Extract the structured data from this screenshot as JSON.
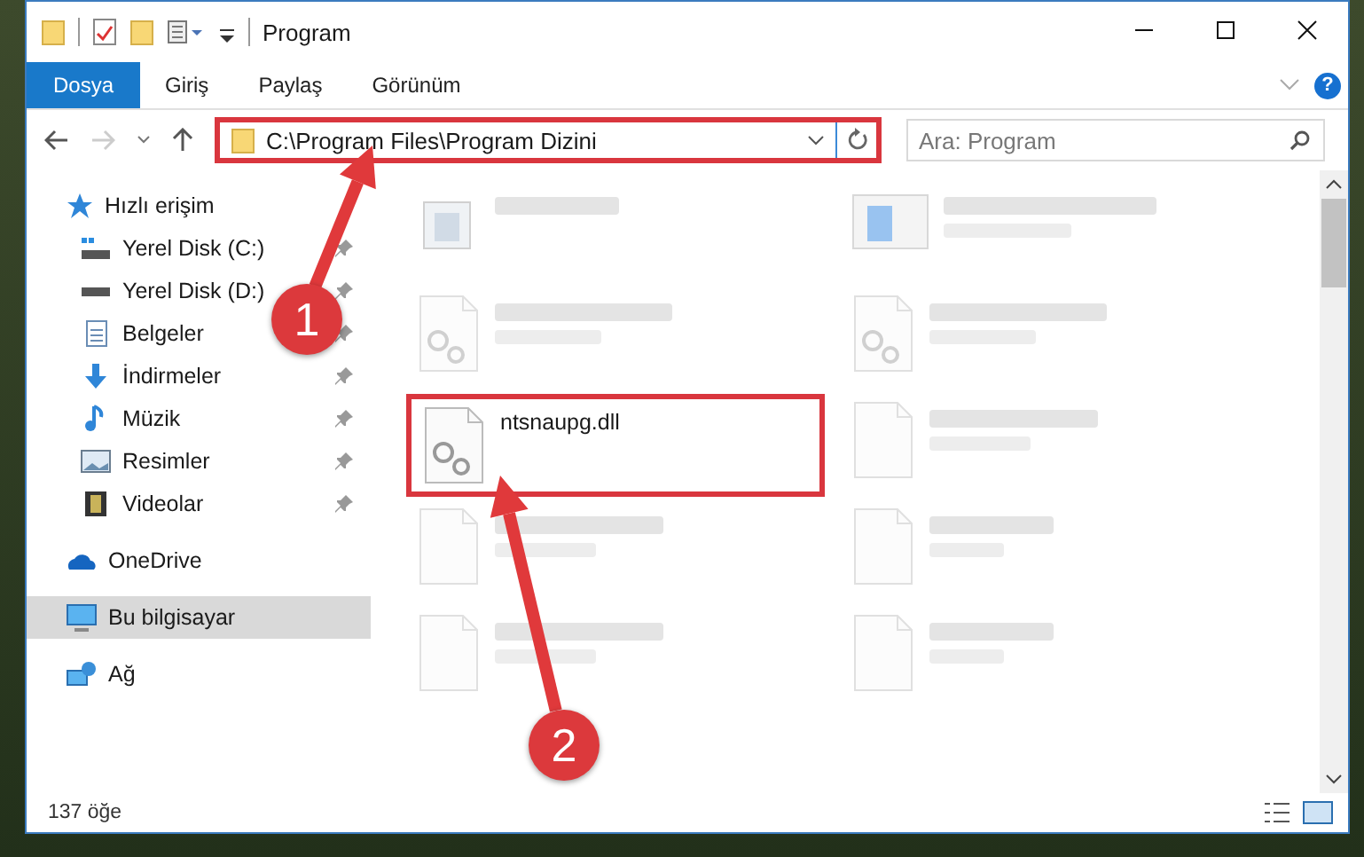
{
  "window": {
    "title": "Program"
  },
  "ribbon": {
    "tabs": [
      {
        "label": "Dosya",
        "selected": true
      },
      {
        "label": "Giriş",
        "selected": false
      },
      {
        "label": "Paylaş",
        "selected": false
      },
      {
        "label": "Görünüm",
        "selected": false
      }
    ],
    "help_glyph": "?"
  },
  "address_bar": {
    "path": "C:\\Program Files\\Program Dizini",
    "highlighted": true
  },
  "search": {
    "placeholder": "Ara: Program"
  },
  "sidebar": {
    "items": [
      {
        "label": "Hızlı erişim",
        "kind": "star",
        "selected": false,
        "children": [
          {
            "label": "Yerel Disk (C:)",
            "kind": "drive-windows",
            "pinned": true
          },
          {
            "label": "Yerel Disk (D:)",
            "kind": "drive",
            "pinned": true
          },
          {
            "label": "Belgeler",
            "kind": "documents",
            "pinned": true
          },
          {
            "label": "İndirmeler",
            "kind": "download",
            "pinned": true
          },
          {
            "label": "Müzik",
            "kind": "music",
            "pinned": true
          },
          {
            "label": "Resimler",
            "kind": "pictures",
            "pinned": true
          },
          {
            "label": "Videolar",
            "kind": "videos",
            "pinned": true
          }
        ]
      },
      {
        "label": "OneDrive",
        "kind": "cloud",
        "selected": false
      },
      {
        "label": "Bu bilgisayar",
        "kind": "computer",
        "selected": true
      },
      {
        "label": "Ağ",
        "kind": "network",
        "selected": false
      }
    ]
  },
  "files": [
    {
      "kind": "app",
      "blurred": true,
      "highlighted": false
    },
    {
      "kind": "installer",
      "blurred": true,
      "highlighted": false
    },
    {
      "kind": "dll",
      "blurred": true,
      "highlighted": false
    },
    {
      "kind": "dll",
      "blurred": true,
      "highlighted": false
    },
    {
      "name": "ntsnaupg.dll",
      "kind": "gears",
      "blurred": false,
      "highlighted": true
    },
    {
      "kind": "blank",
      "blurred": true,
      "highlighted": false
    },
    {
      "kind": "blank",
      "blurred": true,
      "highlighted": false
    },
    {
      "kind": "blank",
      "blurred": true,
      "highlighted": false
    },
    {
      "kind": "blank",
      "blurred": true,
      "highlighted": false
    },
    {
      "kind": "blank",
      "blurred": true,
      "highlighted": false
    }
  ],
  "status_bar": {
    "count": "137 öğe"
  },
  "annotations": [
    {
      "number": "1"
    },
    {
      "number": "2"
    }
  ]
}
